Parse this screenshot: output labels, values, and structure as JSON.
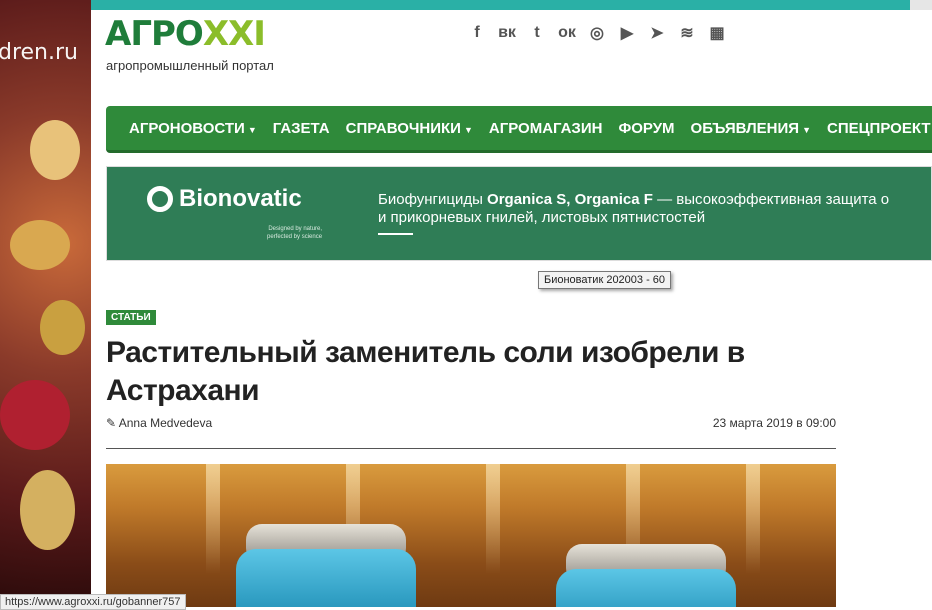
{
  "left_ad": {
    "text": "dren.ru"
  },
  "logo": {
    "part1": "АГРО",
    "part2": "XXI",
    "tagline": "агропромышленный портал"
  },
  "social_icons": [
    "facebook-icon",
    "vk-icon",
    "twitter-icon",
    "odnoklassniki-icon",
    "instagram-icon",
    "youtube-icon",
    "telegram-icon",
    "rss-icon",
    "grid-icon"
  ],
  "social_glyphs": [
    "f",
    "вк",
    "t",
    "ок",
    "◎",
    "▶",
    "➤",
    "≋",
    "▦"
  ],
  "nav": {
    "items": [
      {
        "label": "АГРОНОВОСТИ",
        "dropdown": true
      },
      {
        "label": "ГАЗЕТА",
        "dropdown": false
      },
      {
        "label": "СПРАВОЧНИКИ",
        "dropdown": true
      },
      {
        "label": "АГРОМАГАЗИН",
        "dropdown": false
      },
      {
        "label": "ФОРУМ",
        "dropdown": false
      },
      {
        "label": "ОБЪЯВЛЕНИЯ",
        "dropdown": true
      },
      {
        "label": "СПЕЦПРОЕКТ",
        "dropdown": false
      }
    ]
  },
  "banner": {
    "brand": "Bionovatic",
    "slogan_line1": "Designed by nature,",
    "slogan_line2": "perfected by science",
    "text_line1_prefix": "Биофунгициды ",
    "text_line1_bold": "Organica S, Organica F",
    "text_line1_suffix": " — высокоэффективная защита о",
    "text_line2": "и прикорневых гнилей, листовых пятнистостей"
  },
  "tooltip": "Бионоватик 202003 - 60",
  "article": {
    "category": "СТАТЬИ",
    "title": "Растительный заменитель соли изобрели в Астрахани",
    "author": "Anna Medvedeva",
    "date": "23 марта 2019 в 09:00"
  },
  "status_bar": "https://www.agroxxi.ru/gobanner757"
}
